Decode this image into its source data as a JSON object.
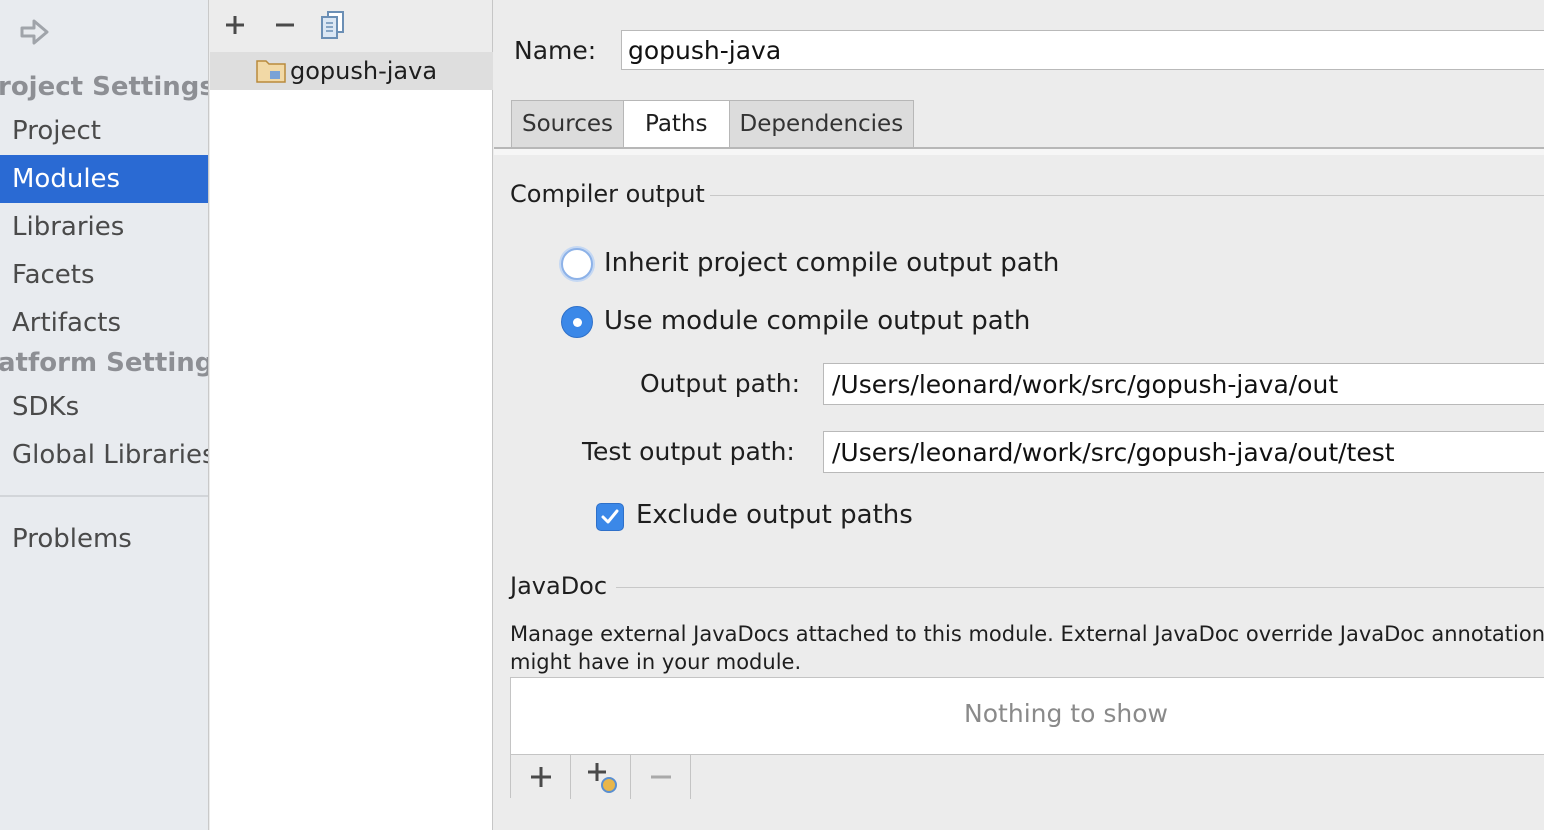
{
  "nav": {
    "project_settings_header": "roject Settings",
    "platform_settings_header": "atform Settings",
    "items": {
      "project": "Project",
      "modules": "Modules",
      "libraries": "Libraries",
      "facets": "Facets",
      "artifacts": "Artifacts",
      "sdks": "SDKs",
      "global_libraries": "Global Libraries",
      "problems": "Problems"
    },
    "selected": "Modules"
  },
  "module_list": {
    "toolbar_icons": [
      "plus-icon",
      "minus-icon",
      "copy-icon"
    ],
    "modules": [
      "gopush-java"
    ]
  },
  "detail": {
    "name_label": "Name:",
    "name_value": "gopush-java",
    "tabs": [
      "Sources",
      "Paths",
      "Dependencies"
    ],
    "active_tab": "Paths",
    "compiler_output": {
      "title": "Compiler output",
      "inherit_label": "Inherit project compile output path",
      "use_module_label": "Use module compile output path",
      "selected": "Use module compile output path",
      "output_path_label": "Output path:",
      "output_path_value": "/Users/leonard/work/src/gopush-java/out",
      "test_output_path_label": "Test output path:",
      "test_output_path_value": "/Users/leonard/work/src/gopush-java/out/test",
      "exclude_label": "Exclude output paths",
      "exclude_checked": true
    },
    "javadoc": {
      "title": "JavaDoc",
      "description_line1": "Manage external JavaDocs attached to this module. External JavaDoc override JavaDoc annotation",
      "description_line2": "might have in your module.",
      "empty_text": "Nothing to show",
      "toolbar_icons": [
        "plus-icon",
        "add-url-icon",
        "minus-icon"
      ]
    }
  },
  "colors": {
    "selection": "#2a6ad3",
    "accent": "#3b88e8",
    "nav_background": "#e8ebef",
    "pane_background": "#ececec"
  }
}
